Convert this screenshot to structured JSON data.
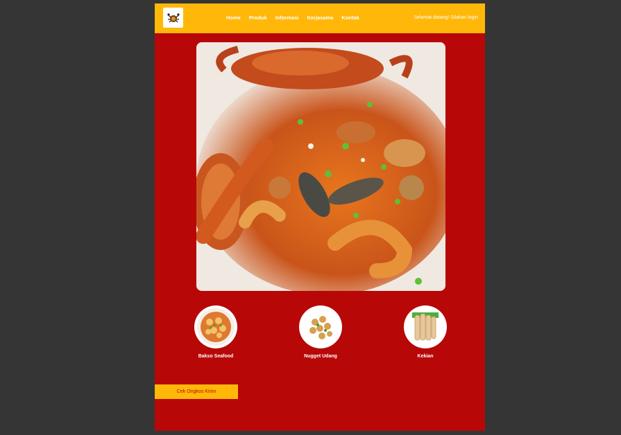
{
  "header": {
    "nav": [
      "Home",
      "Produk",
      "Informasi",
      "Kerjasama",
      "Kontak"
    ],
    "welcome": "Selamat datang! Silakan login"
  },
  "products": [
    {
      "name": "Bakso Seafood"
    },
    {
      "name": "Nugget Udang"
    },
    {
      "name": "Kekian"
    }
  ],
  "cta": {
    "label": "Cek Ongkos Kirim"
  },
  "colors": {
    "header": "#ffb809",
    "page": "#b70707",
    "backdrop": "#353535"
  }
}
